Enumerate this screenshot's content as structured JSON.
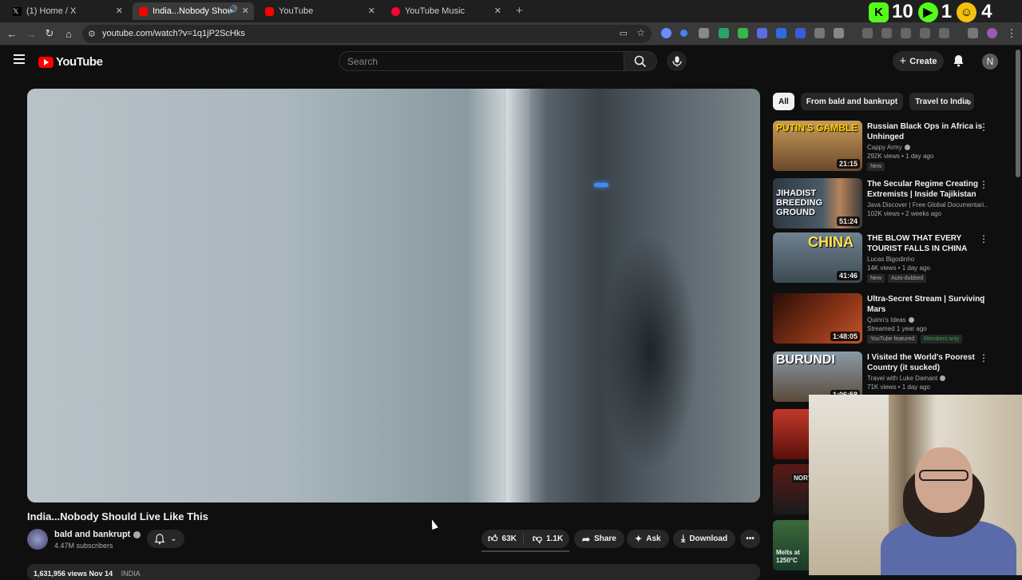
{
  "browser": {
    "tabs": [
      {
        "label": "(1) Home / X",
        "icon": "x-logo-icon",
        "active": false
      },
      {
        "label": "India...Nobody Should Live",
        "icon": "youtube-favicon-icon",
        "active": true
      },
      {
        "label": "YouTube",
        "icon": "youtube-favicon-icon",
        "active": false
      },
      {
        "label": "YouTube Music",
        "icon": "youtube-music-favicon-icon",
        "active": false
      }
    ],
    "url": "youtube.com/watch?v=1q1jP2ScHks",
    "overlay": {
      "count_a": "10",
      "count_b": "1",
      "count_c": "4"
    }
  },
  "youtube": {
    "logo_text": "YouTube",
    "search_placeholder": "Search",
    "create_label": "Create",
    "avatar_letter": "N"
  },
  "video": {
    "title": "India...Nobody Should Live Like This",
    "channel": "bald and bankrupt",
    "subscribers": "4.47M subscribers",
    "likes": "63K",
    "dislikes": "1.1K",
    "share_label": "Share",
    "ask_label": "Ask",
    "download_label": "Download",
    "views_date": "1,631,956 views  Nov 14",
    "tag": "INDIA"
  },
  "chips": [
    "All",
    "From bald and bankrupt",
    "Travel to India"
  ],
  "recommendations": [
    {
      "title": "Russian Black Ops in Africa is Unhinged",
      "channel": "Cappy Army",
      "verified": true,
      "meta": "292K views • 1 day ago",
      "badges": [
        "New"
      ],
      "duration": "21:15",
      "thumb_text": "PUTIN'S GAMBLE",
      "thumb_color": "#a07848"
    },
    {
      "title": "The Secular Regime Creating Extremists | Inside Tajikistan",
      "channel": "Java Discover | Free Global Documentari...",
      "verified": false,
      "meta": "102K views • 2 weeks ago",
      "badges": [],
      "duration": "51:24",
      "thumb_text": "JIHADIST BREEDING GROUND",
      "thumb_color": "#3a4652"
    },
    {
      "title": "THE BLOW THAT EVERY TOURIST FALLS IN CHINA",
      "channel": "Lucas Bigodinho",
      "verified": false,
      "meta": "14K views • 1 day ago",
      "badges": [
        "New",
        "Auto-dubbed"
      ],
      "duration": "41:46",
      "thumb_text": "CHINA",
      "thumb_color": "#5a6d7a"
    },
    {
      "title": "Ultra-Secret Stream | Surviving Mars",
      "channel": "Quinn's Ideas",
      "verified": true,
      "meta": "Streamed 1 year ago",
      "badges": [
        "YouTube featured",
        "Members only"
      ],
      "duration": "1:48:05",
      "thumb_text": "",
      "thumb_color": "#6a2a18"
    },
    {
      "title": "I Visited the World's Poorest Country (it sucked)",
      "channel": "Travel with Luke Damant",
      "verified": true,
      "meta": "71K views • 1 day ago",
      "badges": [],
      "duration": "1:06:58",
      "thumb_text": "BURUNDI",
      "thumb_color": "#7a8a96"
    }
  ],
  "side_partial_text": [
    "NORT",
    "Melts at 1250°C"
  ],
  "colors": {
    "brand_red": "#ff0000",
    "background": "#0f0f0f",
    "chip_bg": "#272727"
  }
}
